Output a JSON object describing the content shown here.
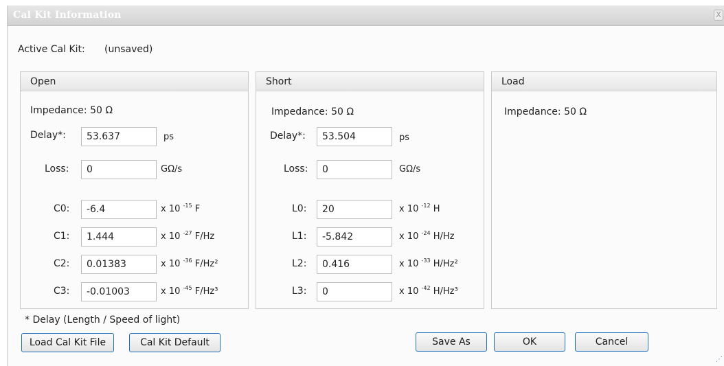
{
  "dialog": {
    "title": "Cal Kit Information",
    "close_label": "X"
  },
  "active": {
    "label": "Active Cal Kit:",
    "value": "(unsaved)"
  },
  "open": {
    "header": "Open",
    "impedance": "Impedance:  50 Ω",
    "delay_label": "Delay*:",
    "delay_value": "53.637",
    "delay_unit": "ps",
    "loss_label": "Loss:",
    "loss_value": "0",
    "loss_unit": "GΩ/s",
    "coeffs": [
      {
        "label": "C0:",
        "value": "-6.4",
        "unit_pre": "x 10",
        "exp": "-15",
        "unit_post": "F"
      },
      {
        "label": "C1:",
        "value": "1.444",
        "unit_pre": "x 10",
        "exp": "-27",
        "unit_post": "F/Hz"
      },
      {
        "label": "C2:",
        "value": "0.01383",
        "unit_pre": "x 10",
        "exp": "-36",
        "unit_post": "F/Hz²"
      },
      {
        "label": "C3:",
        "value": "-0.01003",
        "unit_pre": "x 10",
        "exp": "-45",
        "unit_post": "F/Hz³"
      }
    ]
  },
  "short": {
    "header": "Short",
    "impedance": "Impedance:  50 Ω",
    "delay_label": "Delay*:",
    "delay_value": "53.504",
    "delay_unit": "ps",
    "loss_label": "Loss:",
    "loss_value": "0",
    "loss_unit": "GΩ/s",
    "coeffs": [
      {
        "label": "L0:",
        "value": "20",
        "unit_pre": "x 10",
        "exp": "-12",
        "unit_post": "H"
      },
      {
        "label": "L1:",
        "value": "-5.842",
        "unit_pre": "x 10",
        "exp": "-24",
        "unit_post": "H/Hz"
      },
      {
        "label": "L2:",
        "value": "0.416",
        "unit_pre": "x 10",
        "exp": "-33",
        "unit_post": "H/Hz²"
      },
      {
        "label": "L3:",
        "value": "0",
        "unit_pre": "x 10",
        "exp": "-42",
        "unit_post": "H/Hz³"
      }
    ]
  },
  "load": {
    "header": "Load",
    "impedance": "Impedance:  50 Ω"
  },
  "footer": {
    "note": "* Delay (Length / Speed of light)",
    "load_file": "Load Cal Kit File",
    "default": "Cal Kit Default",
    "save_as": "Save As",
    "ok": "OK",
    "cancel": "Cancel"
  }
}
